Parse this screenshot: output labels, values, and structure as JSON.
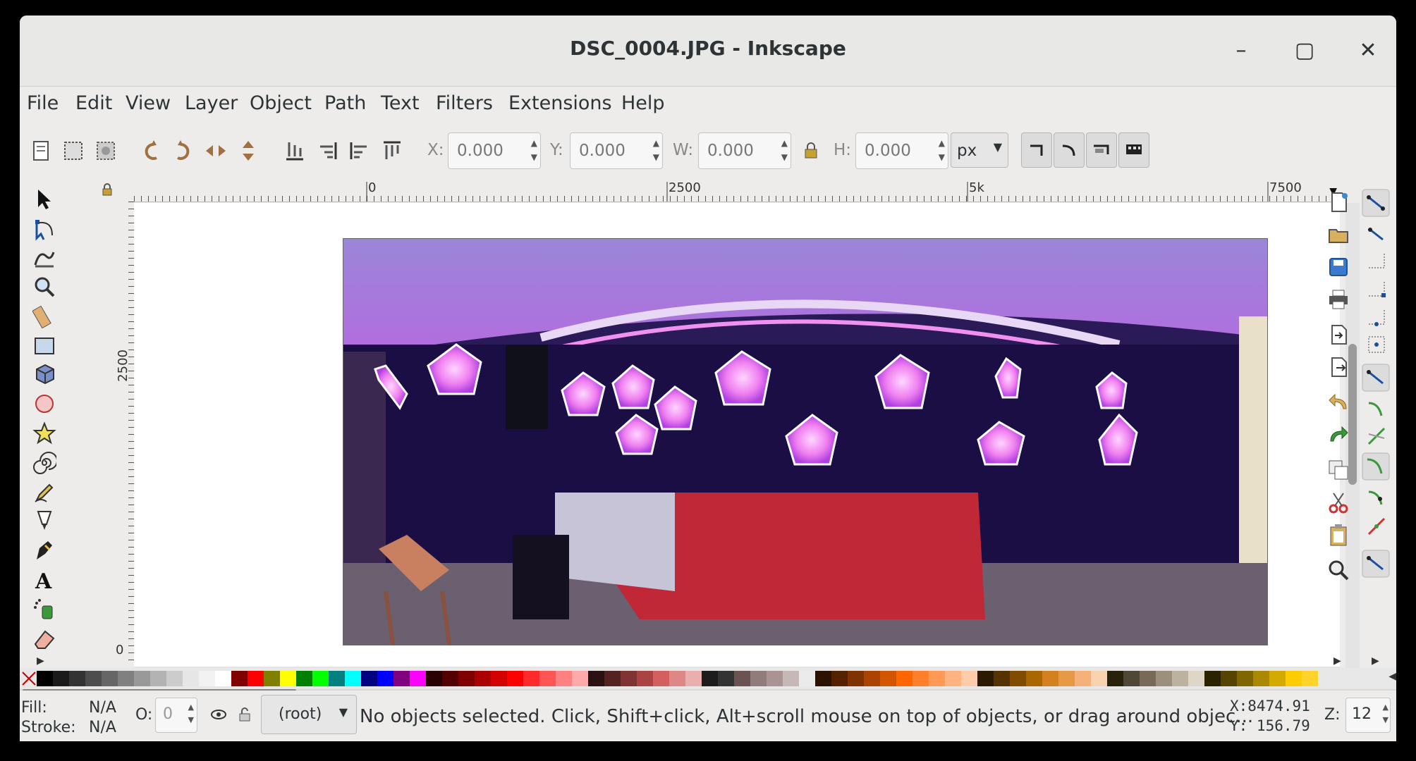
{
  "window": {
    "title": "DSC_0004.JPG - Inkscape"
  },
  "window_controls": {
    "minimize": "–",
    "maximize": "▢",
    "close": "✕"
  },
  "menubar": {
    "items": [
      "File",
      "Edit",
      "View",
      "Layer",
      "Object",
      "Path",
      "Text",
      "Filters",
      "Extensions",
      "Help"
    ]
  },
  "toolbar": {
    "x_label": "X:",
    "x_value": "0.000",
    "y_label": "Y:",
    "y_value": "0.000",
    "w_label": "W:",
    "w_value": "0.000",
    "h_label": "H:",
    "h_value": "0.000",
    "unit": "px"
  },
  "rulers": {
    "h_labels": [
      "0",
      "2500",
      "5k",
      "7500"
    ],
    "v_labels": [
      "2500",
      "0"
    ]
  },
  "statusbar": {
    "fill_label": "Fill:",
    "fill_value": "N/A",
    "stroke_label": "Stroke:",
    "stroke_value": "N/A",
    "opacity_label": "O:",
    "opacity_value": "0",
    "layer": "(root)",
    "message": "No objects selected. Click, Shift+click, Alt+scroll mouse on top of objects, or drag around objec...",
    "x_coord": "X:8474.91",
    "y_coord": "Y: 156.79",
    "zoom_label": "Z:",
    "zoom_value": "12"
  },
  "palette_colors": [
    "#000000",
    "#1a1a1a",
    "#333333",
    "#4d4d4d",
    "#666666",
    "#808080",
    "#999999",
    "#b3b3b3",
    "#cccccc",
    "#e6e6e6",
    "#f2f2f2",
    "#ffffff",
    "#800000",
    "#ff0000",
    "#808000",
    "#ffff00",
    "#008000",
    "#00ff00",
    "#008080",
    "#00ffff",
    "#000080",
    "#0000ff",
    "#800080",
    "#ff00ff",
    "#2b0000",
    "#550000",
    "#800000",
    "#aa0000",
    "#d40000",
    "#ff0000",
    "#ff2a2a",
    "#ff5555",
    "#ff8080",
    "#ffaaaa",
    "#2b1111",
    "#552222",
    "#803333",
    "#aa4444",
    "#d35f5f",
    "#de8787",
    "#e9afaf",
    "#1c1c1c",
    "#333",
    "#6c5353",
    "#917c7c",
    "#ac9393",
    "#c8b7b7",
    "#ebebeb",
    "#2b1100",
    "#552200",
    "#803300",
    "#aa4400",
    "#d45500",
    "#ff6600",
    "#ff7f2a",
    "#ff9955",
    "#ffb380",
    "#ffccaa",
    "#2b1a00",
    "#553300",
    "#804d00",
    "#aa6600",
    "#d4801f",
    "#e69a46",
    "#f4b27a",
    "#f9d2b0",
    "#28220b",
    "#504837",
    "#786a56",
    "#9c8f7c",
    "#bdb29f",
    "#ded6c6",
    "#2b2200",
    "#554400",
    "#806600",
    "#aa8800",
    "#d4aa00",
    "#ffcc00",
    "#ffd42a"
  ]
}
